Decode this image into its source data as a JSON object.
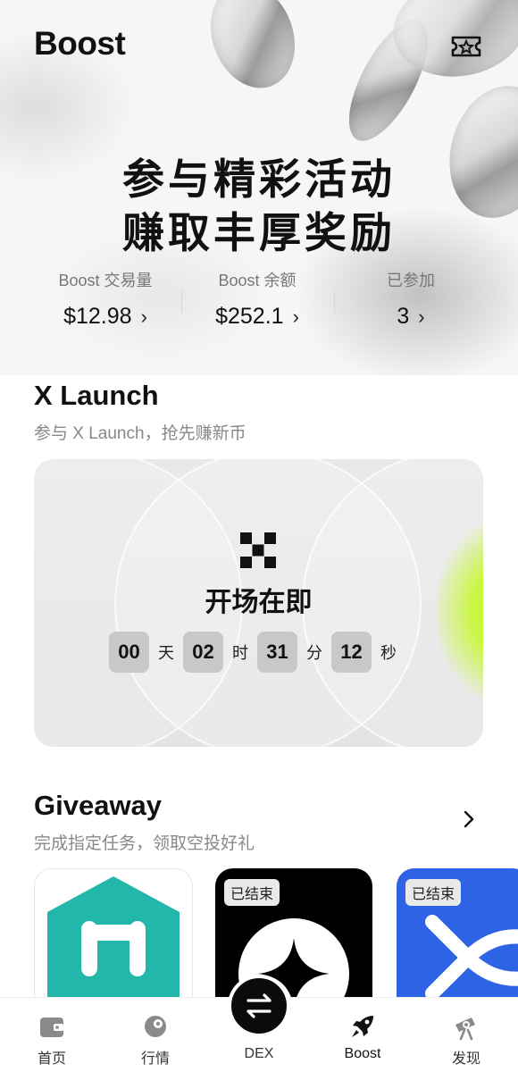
{
  "header": {
    "title": "Boost",
    "ticket_icon": "ticket-icon"
  },
  "hero": {
    "line1": "参与精彩活动",
    "line2": "赚取丰厚奖励"
  },
  "stats": [
    {
      "label": "Boost 交易量",
      "value": "$12.98"
    },
    {
      "label": "Boost 余额",
      "value": "$252.1"
    },
    {
      "label": "已参加",
      "value": "3"
    }
  ],
  "chevron": "›",
  "x_launch": {
    "title": "X Launch",
    "subtitle": "参与 X Launch，抢先赚新币",
    "status": "开场在即",
    "countdown": [
      {
        "value": "00",
        "unit": "天"
      },
      {
        "value": "02",
        "unit": "时"
      },
      {
        "value": "31",
        "unit": "分"
      },
      {
        "value": "12",
        "unit": "秒"
      }
    ]
  },
  "giveaway": {
    "title": "Giveaway",
    "subtitle": "完成指定任务，领取空投好礼",
    "cards": [
      {
        "badge": "",
        "colors": {
          "bg": "#ffffff",
          "logo": "#22b7aa"
        }
      },
      {
        "badge": "已结束",
        "colors": {
          "bg": "#000000",
          "logo": "#ffffff"
        }
      },
      {
        "badge": "已结束",
        "colors": {
          "bg": "#2f63e6",
          "logo": "#ffffff"
        }
      }
    ]
  },
  "bottom_nav": [
    {
      "label": "首页",
      "icon": "wallet-icon"
    },
    {
      "label": "行情",
      "icon": "market-icon"
    },
    {
      "label": "DEX",
      "icon": "swap-icon"
    },
    {
      "label": "Boost",
      "icon": "rocket-icon",
      "active": true
    },
    {
      "label": "发现",
      "icon": "telescope-icon"
    }
  ],
  "colors": {
    "accent_lime": "#c9f743",
    "text": "#111111",
    "muted": "#888888"
  }
}
